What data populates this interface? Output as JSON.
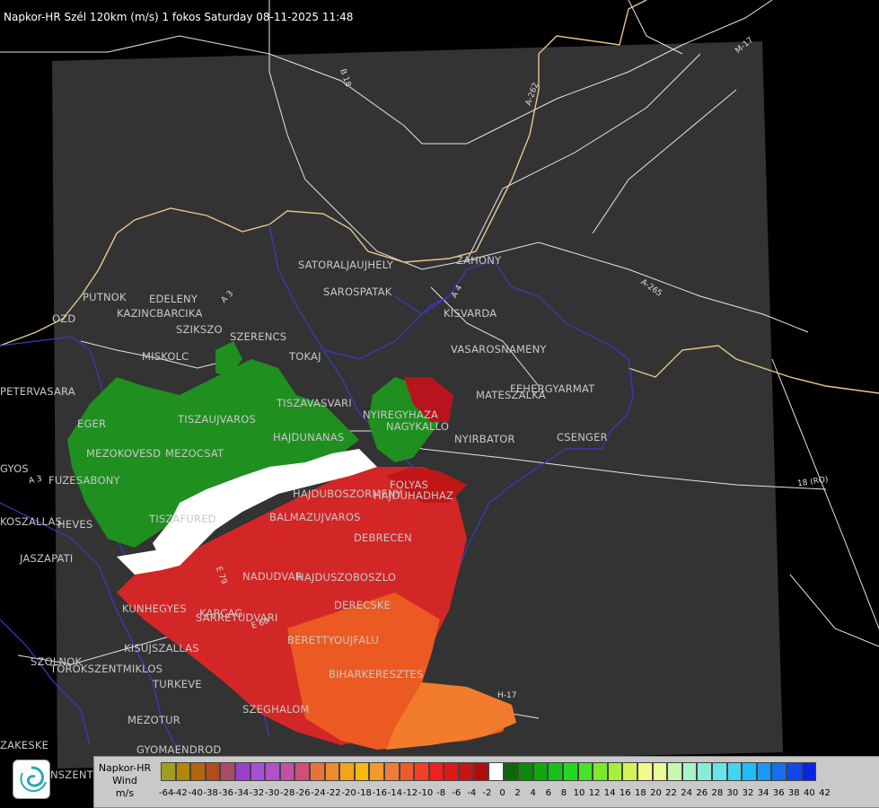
{
  "title": "Napkor-HR Szél 120km (m/s) 1 fokos Saturday 08-11-2025 11:48",
  "places": [
    "SATORALJAUJHELY",
    "SAROSPATAK",
    "ZAHONY",
    "KISVARDA",
    "VASAROSNAMENY",
    "FEHERGYARMAT",
    "MATESZALKA",
    "NYIRBATOR",
    "CSENGER",
    "PUTNOK",
    "EDELENY",
    "KAZINCBARCIKA",
    "SZIKSZO",
    "SZERENCS",
    "MISKOLC",
    "TOKAJ",
    "PETERVASARA",
    "EGER",
    "TISZAUJVAROS",
    "TISZAVASVARI",
    "NYIREGYHAZA",
    "NAGYKALLO",
    "HAJDUNANAS",
    "MEZOKOVESD",
    "MEZOCSAT",
    "FUZESABONY",
    "HAJDUBOSZORMENY",
    "HAJDUHADHAZ",
    "BALMAZUJVAROS",
    "DEBRECEN",
    "TISZAFURED",
    "HEVES",
    "JASZAPATI",
    "NADUDVAR",
    "HAJDUSZOBOSZLO",
    "DERECSKE",
    "KUNHEGYES",
    "KISUJSZALLAS",
    "KARCAG",
    "BERETTYOUJFALU",
    "BIHARKERESZTES",
    "SZOLNOK",
    "TOROKSZENTMIKLOS",
    "TURKEVE",
    "SZEGHALOM",
    "MEZOTUR",
    "GYOMAENDROD",
    "GYOS",
    "OZD",
    "KOSZALLAS",
    "ZAKESKE",
    "NSZENTM",
    "SARRETUDVARI",
    "FOLYAS"
  ],
  "roads": [
    "B 18",
    "A-262",
    "M-17",
    "A-265",
    "18 (RO)",
    "A 3",
    "A 4",
    "A 3",
    "E 60",
    "E 79",
    "H-17"
  ],
  "legend": {
    "name_line1": "Napkor-HR",
    "name_line2": "Wind",
    "name_line3": "m/s",
    "ticks": [
      "-64",
      "-42",
      "-40",
      "-38",
      "-36",
      "-34",
      "-32",
      "-30",
      "-28",
      "-26",
      "-24",
      "-22",
      "-20",
      "-18",
      "-16",
      "-14",
      "-12",
      "-10",
      "-8",
      "-6",
      "-4",
      "-2",
      "0",
      "2",
      "4",
      "6",
      "8",
      "10",
      "12",
      "14",
      "16",
      "18",
      "20",
      "22",
      "24",
      "26",
      "28",
      "30",
      "32",
      "34",
      "36",
      "38",
      "40",
      "42"
    ],
    "colors": [
      "#9f9f1f",
      "#b3860a",
      "#b2640e",
      "#b24b1f",
      "#a94b63",
      "#9b3fc8",
      "#a64fd6",
      "#b34fc8",
      "#c44fa8",
      "#cf4f7a",
      "#e8723a",
      "#f08b2a",
      "#f5a31a",
      "#f7b80f",
      "#f29a2a",
      "#ee7d3a",
      "#f05a2a",
      "#f43f25",
      "#f02020",
      "#e01818",
      "#c81414",
      "#b00e0e",
      "#ffffff",
      "#0a6a0a",
      "#0c8a0c",
      "#10a810",
      "#18c018",
      "#22d822",
      "#4ae22a",
      "#7aea2a",
      "#a6ef3a",
      "#d2f45a",
      "#f2f88a",
      "#e8fa9a",
      "#c8f8b0",
      "#a8f4c8",
      "#88ecd8",
      "#66e4e8",
      "#44d4f0",
      "#22bcf6",
      "#1a98f6",
      "#1470f0",
      "#0e48ea",
      "#0a22e4"
    ]
  }
}
